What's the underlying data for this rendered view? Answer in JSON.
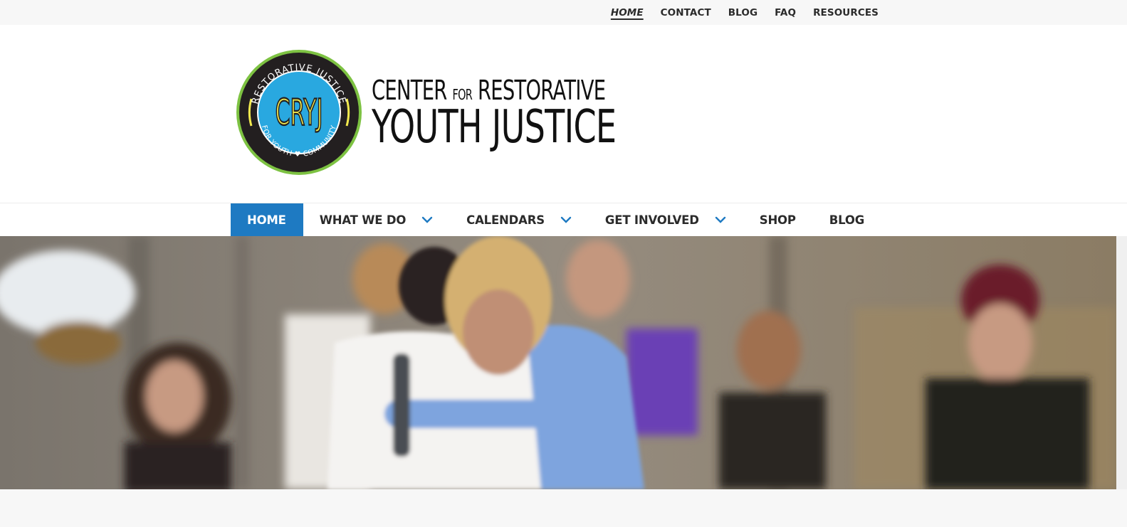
{
  "top_nav": {
    "items": [
      {
        "label": "HOME",
        "active": true
      },
      {
        "label": "CONTACT"
      },
      {
        "label": "BLOG"
      },
      {
        "label": "FAQ"
      },
      {
        "label": "RESOURCES"
      }
    ]
  },
  "logo": {
    "badge_top_text": "RESTORATIVE JUSTICE",
    "badge_center_text": "CRYJ",
    "badge_bottom_text": "FOR YOUTH ♥ COMMUNITY",
    "wordmark_line1_a": "CENTER",
    "wordmark_line1_b": "FOR",
    "wordmark_line1_c": "RESTORATIVE",
    "wordmark_line2": "YOUTH JUSTICE"
  },
  "main_nav": {
    "items": [
      {
        "label": "HOME",
        "active": true,
        "dropdown": false
      },
      {
        "label": "WHAT WE DO",
        "dropdown": true
      },
      {
        "label": "CALENDARS",
        "dropdown": true
      },
      {
        "label": "GET INVOLVED",
        "dropdown": true
      },
      {
        "label": "SHOP",
        "dropdown": false
      },
      {
        "label": "BLOG",
        "dropdown": false
      }
    ]
  },
  "colors": {
    "accent": "#1e7ac2",
    "badge_green": "#7dc242",
    "badge_blue": "#29a8e0",
    "badge_yellow": "#f2e94e",
    "badge_dark": "#231f20"
  }
}
